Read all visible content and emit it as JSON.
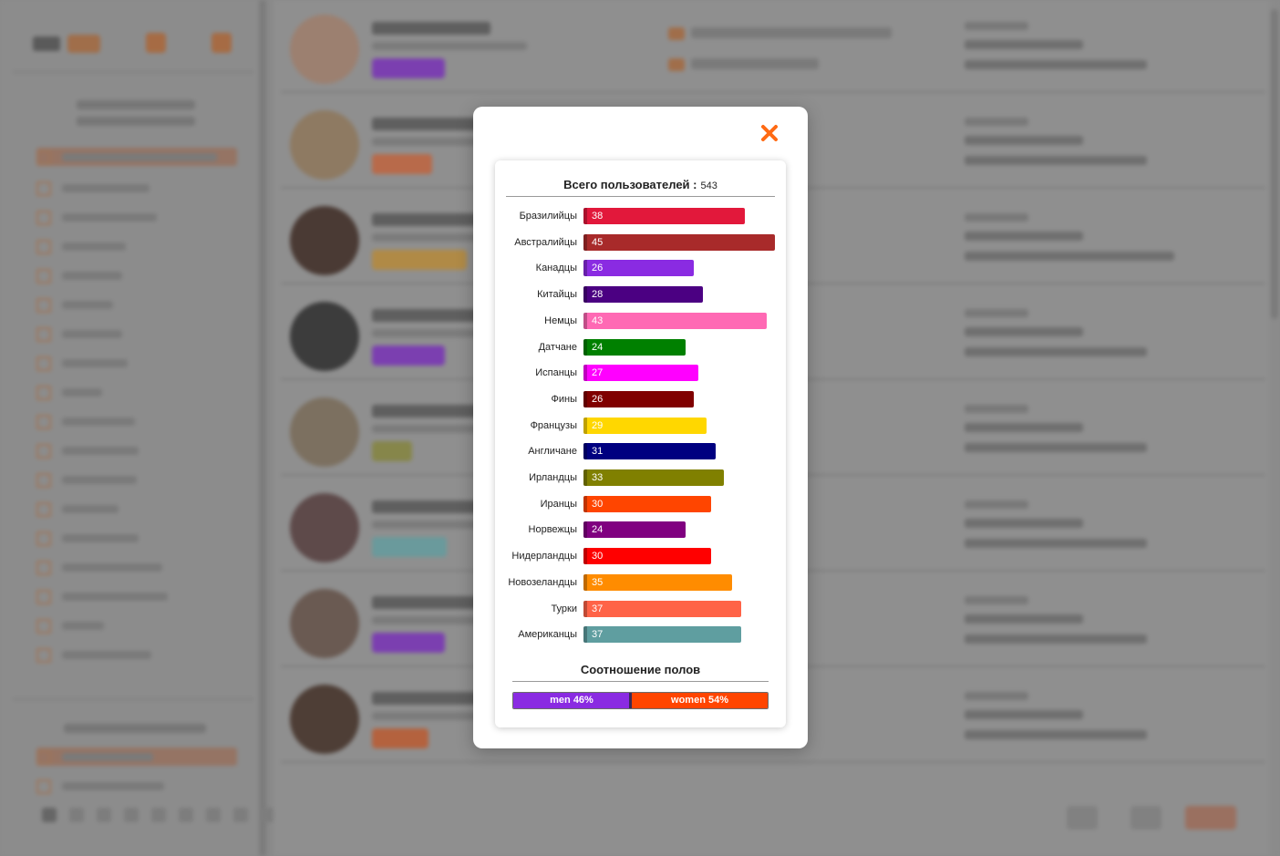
{
  "modal": {
    "close_icon": "close-x-icon",
    "close_color": "#ff6a13",
    "total_label": "Всего пользователей :",
    "total_value": "543",
    "nationalities": [
      {
        "label": "Бразилийцы",
        "value": 38,
        "color": "#e2183b"
      },
      {
        "label": "Австралийцы",
        "value": 45,
        "color": "#a82a2a"
      },
      {
        "label": "Канадцы",
        "value": 26,
        "color": "#8a2be2"
      },
      {
        "label": "Китайцы",
        "value": 28,
        "color": "#4b0082"
      },
      {
        "label": "Немцы",
        "value": 43,
        "color": "#ff69b4"
      },
      {
        "label": "Датчане",
        "value": 24,
        "color": "#008000"
      },
      {
        "label": "Испанцы",
        "value": 27,
        "color": "#ff00ff"
      },
      {
        "label": "Фины",
        "value": 26,
        "color": "#800000"
      },
      {
        "label": "Французы",
        "value": 29,
        "color": "#ffd700"
      },
      {
        "label": "Англичане",
        "value": 31,
        "color": "#000080"
      },
      {
        "label": "Ирландцы",
        "value": 33,
        "color": "#808000"
      },
      {
        "label": "Иранцы",
        "value": 30,
        "color": "#ff4500"
      },
      {
        "label": "Норвежцы",
        "value": 24,
        "color": "#800080"
      },
      {
        "label": "Нидерландцы",
        "value": 30,
        "color": "#ff0000"
      },
      {
        "label": "Новозеландцы",
        "value": 35,
        "color": "#ff8c00"
      },
      {
        "label": "Турки",
        "value": 37,
        "color": "#ff6347"
      },
      {
        "label": "Американцы",
        "value": 37,
        "color": "#5f9ea0"
      }
    ],
    "gender_title": "Соотношение полов",
    "gender": {
      "men_label": "men 46%",
      "men_share": 0.46,
      "men_color": "#8a2be2",
      "women_label": "women 54%",
      "women_share": 0.54,
      "women_color": "#ff4500"
    }
  }
}
